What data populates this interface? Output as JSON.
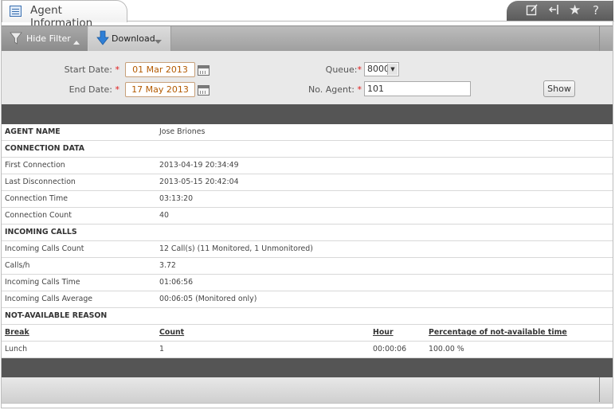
{
  "window": {
    "title": "Agent Information",
    "tools": [
      "edit-icon",
      "collapse-icon",
      "star-icon",
      "help-icon"
    ]
  },
  "toolbar": {
    "hide_filter_label": "Hide Filter",
    "download_label": "Download"
  },
  "filter": {
    "start_date_label": "Start Date:",
    "start_date_value": "01 Mar 2013",
    "end_date_label": "End Date:",
    "end_date_value": "17 May 2013",
    "queue_label": "Queue:",
    "queue_value": "8000",
    "agent_label": "No. Agent:",
    "agent_value": "101",
    "required_mark": "*",
    "show_label": "Show"
  },
  "info": {
    "agent_name_label": "AGENT NAME",
    "agent_name_value": "Jose Briones",
    "connection_section": "CONNECTION DATA",
    "connection_rows": [
      {
        "label": "First Connection",
        "value": "2013-04-19 20:34:49"
      },
      {
        "label": "Last Disconnection",
        "value": "2013-05-15 20:42:04"
      },
      {
        "label": "Connection Time",
        "value": "03:13:20"
      },
      {
        "label": "Connection Count",
        "value": "40"
      }
    ],
    "incoming_section": "INCOMING CALLS",
    "incoming_rows": [
      {
        "label": "Incoming Calls Count",
        "value": "12 Call(s) (11 Monitored, 1 Unmonitored)"
      },
      {
        "label": "Calls/h",
        "value": "3.72"
      },
      {
        "label": "Incoming Calls Time",
        "value": "01:06:56"
      },
      {
        "label": "Incoming Calls Average",
        "value": "00:06:05 (Monitored only)"
      }
    ],
    "na_section": "NOT-AVAILABLE REASON",
    "na_headers": [
      "Break",
      "Count",
      "Hour",
      "Percentage of not-available time"
    ],
    "na_rows": [
      {
        "break": "Lunch",
        "count": "1",
        "hour": "00:00:06",
        "percentage": "100.00 %"
      }
    ]
  }
}
